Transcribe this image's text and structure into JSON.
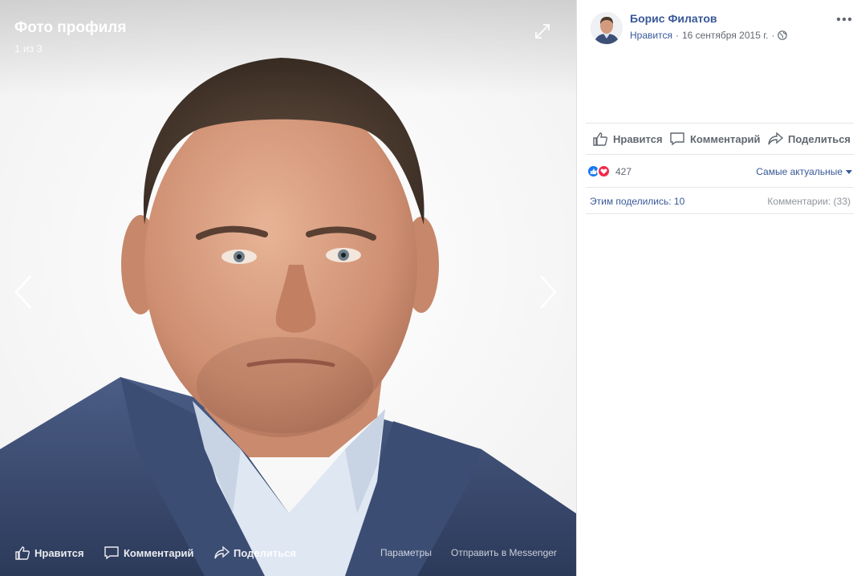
{
  "viewer": {
    "title": "Фото профиля",
    "counter": "1 из 3",
    "footer": {
      "like": "Нравится",
      "comment": "Комментарий",
      "share": "Поделиться",
      "params": "Параметры",
      "messenger": "Отправить в Messenger"
    }
  },
  "post": {
    "author": "Борис Филатов",
    "like_link": "Нравится",
    "separator": "·",
    "date": "16 сентября 2015 г.",
    "separator2": "·",
    "privacy_icon": "globe-icon"
  },
  "actions": {
    "like": "Нравится",
    "comment": "Комментарий",
    "share": "Поделиться"
  },
  "reactions": {
    "count": "427",
    "sort": "Самые актуальные"
  },
  "stats": {
    "shares": "Этим поделились: 10",
    "comments": "Комментарии: (33)"
  },
  "colors": {
    "link": "#385898",
    "like_blue": "#1877f2",
    "love_red": "#f0284a"
  }
}
